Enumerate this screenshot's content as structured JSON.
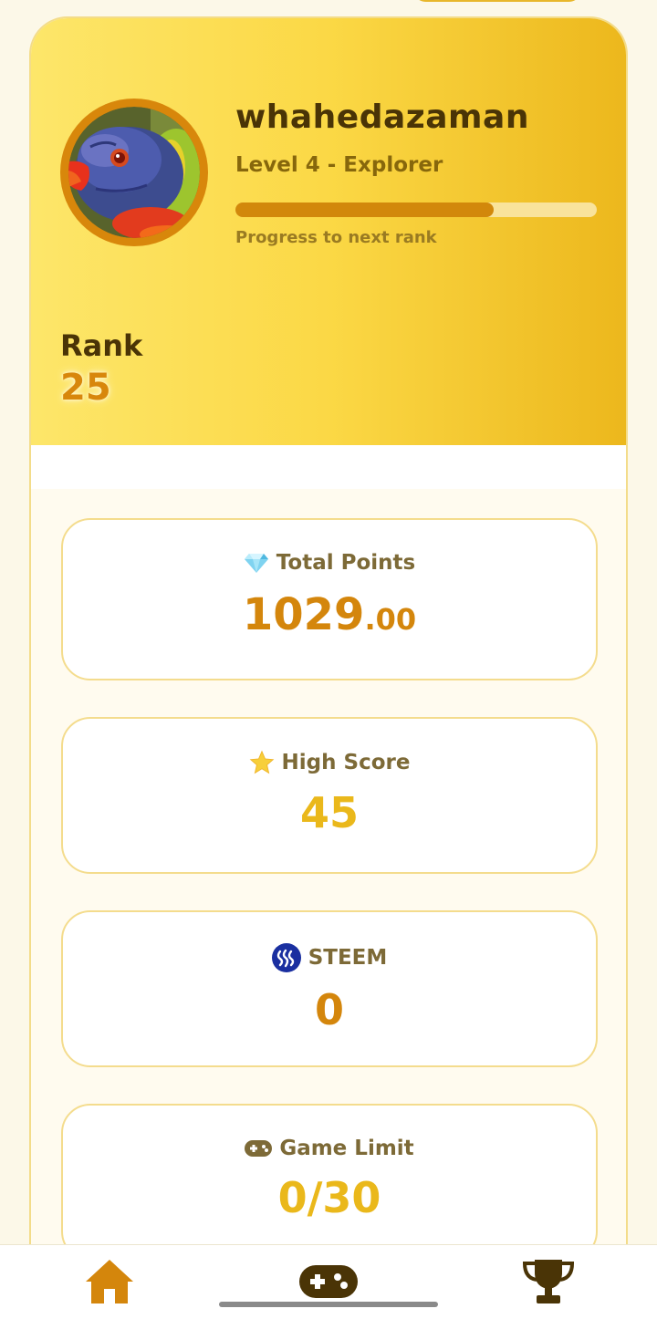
{
  "profile": {
    "username": "whahedazaman",
    "level": "Level 4 - Explorer",
    "progress": 0.715,
    "progress_label": "Progress to next rank",
    "avatar": "rainbow-lorikeet-photo"
  },
  "rank": {
    "label": "Rank",
    "value": "25"
  },
  "stats": {
    "total_points": {
      "icon": "gem-icon",
      "label": "Total Points",
      "value_int": "1029",
      "value_dec": ".00"
    },
    "high_score": {
      "icon": "star-icon",
      "label": "High Score",
      "value": "45"
    },
    "steem": {
      "icon": "steem-logo-icon",
      "label": "STEEM",
      "value": "0"
    },
    "game_limit": {
      "icon": "gamepad-icon",
      "label": "Game Limit",
      "value": "0/30"
    }
  },
  "nav": {
    "items": [
      "home-icon",
      "gamepad-icon",
      "trophy-icon"
    ],
    "active": "home"
  },
  "colors": {
    "accent": "#d4860c",
    "gold": "#eab81b",
    "dark_text": "#4a3406",
    "hero_start": "#fde66a",
    "hero_end": "#ecb71c"
  }
}
